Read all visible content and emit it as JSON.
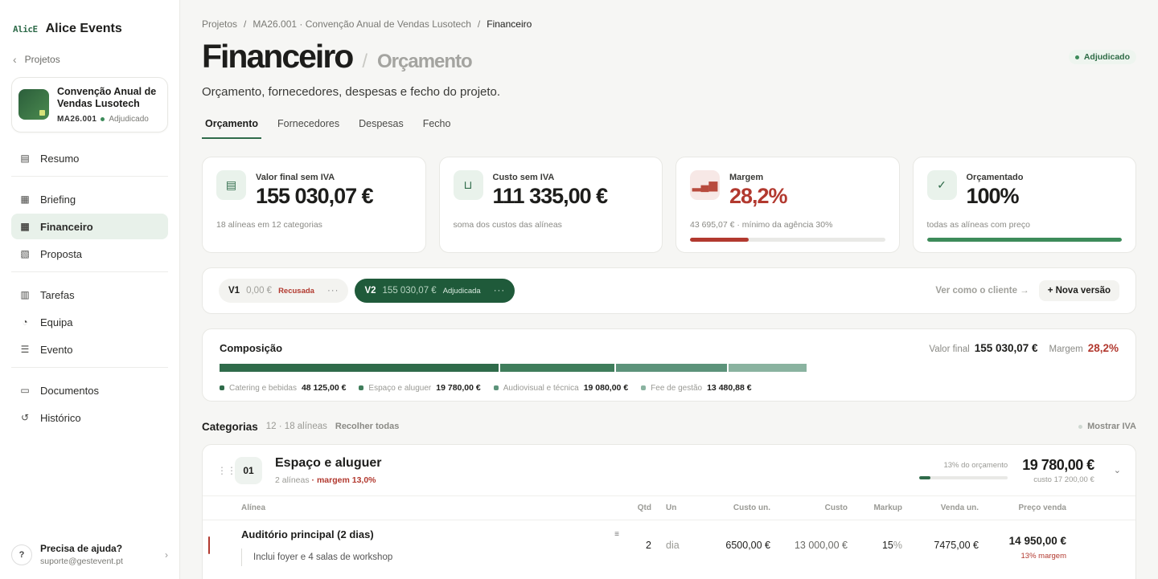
{
  "brand": {
    "logo_text": "AlicE",
    "name": "Alice Events"
  },
  "sidebar": {
    "back_label": "Projetos",
    "project": {
      "title": "Convenção Anual de Vendas Lusotech",
      "code": "MA26.001",
      "status": "Adjudicado"
    },
    "items": [
      {
        "label": "Resumo",
        "icon": "file-icon"
      },
      {
        "label": "Briefing",
        "icon": "doc-icon"
      },
      {
        "label": "Financeiro",
        "icon": "doc-icon"
      },
      {
        "label": "Proposta",
        "icon": "proposal-icon"
      },
      {
        "label": "Tarefas",
        "icon": "board-icon"
      },
      {
        "label": "Equipa",
        "icon": "people-icon"
      },
      {
        "label": "Evento",
        "icon": "sliders-icon"
      },
      {
        "label": "Documentos",
        "icon": "folder-icon"
      },
      {
        "label": "Histórico",
        "icon": "history-icon"
      }
    ],
    "help": {
      "title": "Precisa de ajuda?",
      "email": "suporte@gestevent.pt",
      "icon_label": "?"
    }
  },
  "breadcrumb": {
    "items": [
      "Projetos",
      "MA26.001 · Convenção Anual de Vendas Lusotech",
      "Financeiro"
    ]
  },
  "header": {
    "title": "Financeiro",
    "subtitle": "Orçamento",
    "status": "Adjudicado",
    "description": "Orçamento, fornecedores, despesas e fecho do projeto."
  },
  "tabs": [
    "Orçamento",
    "Fornecedores",
    "Despesas",
    "Fecho"
  ],
  "kpis": [
    {
      "label": "Valor final sem IVA",
      "value": "155 030,07 €",
      "note": "18 alíneas em 12 categorias",
      "icon": "document-icon"
    },
    {
      "label": "Custo sem IVA",
      "value": "111 335,00 €",
      "note": "soma dos custos das alíneas",
      "icon": "cart-icon"
    },
    {
      "label": "Margem",
      "value": "28,2%",
      "note": "43 695,07 € · mínimo da agência 30%",
      "icon": "chart-icon",
      "progress": 0.3
    },
    {
      "label": "Orçamentado",
      "value": "100%",
      "note": "todas as alíneas com preço",
      "icon": "check-icon",
      "progress": 1.0
    }
  ],
  "colors": {
    "accent": "#2f6b4a",
    "danger": "#b2392f",
    "dark_green": "#1f5a3a"
  },
  "versions": [
    {
      "name": "V1",
      "value": "0,00 €",
      "status": "Recusada"
    },
    {
      "name": "V2",
      "value": "155 030,07 €",
      "status": "Adjudicada"
    }
  ],
  "version_actions": {
    "view_client": "Ver como o cliente →",
    "new_version": "+ Nova versão",
    "more": "···"
  },
  "composition": {
    "title": "Composição",
    "final_label": "Valor final",
    "final_value": "155 030,07 €",
    "margin_label": "Margem",
    "margin_value": "28,2%",
    "segments": [
      {
        "name": "Catering e bebidas",
        "value": "48 125,00 €",
        "amount": 48125.0,
        "color": "#2f6b4a"
      },
      {
        "name": "Espaço e aluguer",
        "value": "19 780,00 €",
        "amount": 19780.0,
        "color": "#3f7d5b"
      },
      {
        "name": "Audiovisual e técnica",
        "value": "19 080,00 €",
        "amount": 19080.0,
        "color": "#5c937a"
      },
      {
        "name": "Fee de gestão",
        "value": "13 480,88 €",
        "amount": 13480.88,
        "color": "#8ab3a0"
      }
    ]
  },
  "categories": {
    "title": "Categorias",
    "count": "12 · 18 alíneas",
    "collapse_label": "Recolher todas",
    "vat_label": "Mostrar IVA",
    "items": [
      {
        "number": "01",
        "name": "Espaço e aluguer",
        "lines": "2 alíneas",
        "margin": "· margem 13,0%",
        "share_label": "13% do orçamento",
        "share": 0.13,
        "total": "19 780,00 €",
        "cost": "custo 17 200,00 €"
      }
    ]
  },
  "table": {
    "headers": {
      "name": "Alínea",
      "qtd": "Qtd",
      "un": "Un",
      "cu": "Custo un.",
      "c": "Custo",
      "mk": "Markup",
      "vu": "Venda un.",
      "pv": "Preço venda"
    },
    "rows": [
      {
        "name": "Auditório principal (2 dias)",
        "note": "Inclui foyer e 4 salas de workshop",
        "qtd": "2",
        "un": "dia",
        "cu": "6500,00 €",
        "c": "13 000,00 €",
        "mk": "15",
        "mk_unit": "%",
        "vu": "7475,00 €",
        "pv": "14 950,00 €",
        "pv_margin": "13% margem"
      }
    ]
  }
}
